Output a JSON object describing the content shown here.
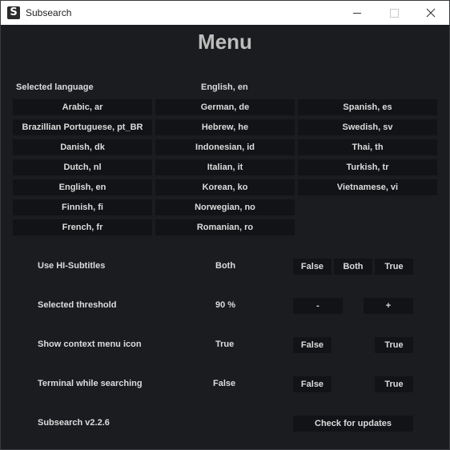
{
  "window": {
    "title": "Subsearch",
    "icon_letter": "S"
  },
  "heading": "Menu",
  "language": {
    "label": "Selected language",
    "current": "English, en",
    "columns": [
      [
        "Arabic, ar",
        "Brazillian Portuguese, pt_BR",
        "Danish, dk",
        "Dutch, nl",
        "English, en",
        "Finnish, fi",
        "French, fr"
      ],
      [
        "German, de",
        "Hebrew, he",
        "Indonesian, id",
        "Italian, it",
        "Korean, ko",
        "Norwegian, no",
        "Romanian, ro"
      ],
      [
        "Spanish, es",
        "Swedish, sv",
        "Thai, th",
        "Turkish, tr",
        "Vietnamese, vi"
      ]
    ]
  },
  "hi_subtitles": {
    "label": "Use HI-Subtitles",
    "value": "Both",
    "false_label": "False",
    "both_label": "Both",
    "true_label": "True"
  },
  "threshold": {
    "label": "Selected threshold",
    "value": "90 %",
    "minus_label": "-",
    "plus_label": "+"
  },
  "context_menu": {
    "label": "Show context menu icon",
    "value": "True",
    "false_label": "False",
    "true_label": "True"
  },
  "terminal": {
    "label": "Terminal while searching",
    "value": "False",
    "false_label": "False",
    "true_label": "True"
  },
  "version": {
    "label": "Subsearch v2.2.6",
    "update_button": "Check for updates"
  }
}
